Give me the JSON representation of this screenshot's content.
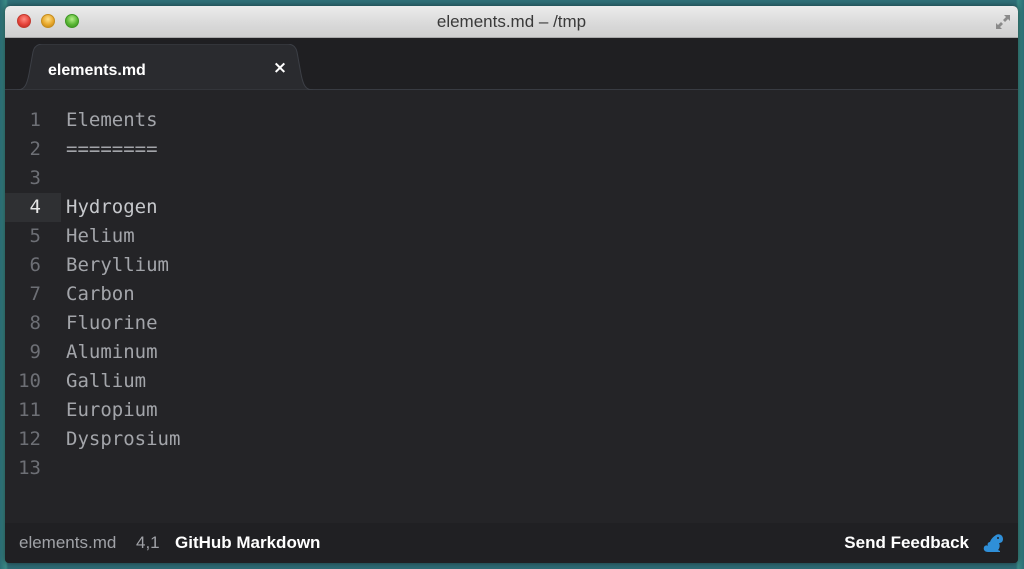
{
  "window": {
    "title": "elements.md – /tmp"
  },
  "tabs": [
    {
      "label": "elements.md",
      "close_icon": "close-icon",
      "close_glyph": "×"
    }
  ],
  "editor": {
    "current_line": 4,
    "lines": [
      {
        "number": "1",
        "text": "Elements"
      },
      {
        "number": "2",
        "text": "========"
      },
      {
        "number": "3",
        "text": ""
      },
      {
        "number": "4",
        "text": "Hydrogen"
      },
      {
        "number": "5",
        "text": "Helium"
      },
      {
        "number": "6",
        "text": "Beryllium"
      },
      {
        "number": "7",
        "text": "Carbon"
      },
      {
        "number": "8",
        "text": "Fluorine"
      },
      {
        "number": "9",
        "text": "Aluminum"
      },
      {
        "number": "10",
        "text": "Gallium"
      },
      {
        "number": "11",
        "text": "Europium"
      },
      {
        "number": "12",
        "text": "Dysprosium"
      },
      {
        "number": "13",
        "text": ""
      }
    ]
  },
  "statusbar": {
    "file": "elements.md",
    "cursor": "4,1",
    "grammar": "GitHub Markdown",
    "feedback_label": "Send Feedback",
    "feedback_icon": "squirrel-icon"
  },
  "colors": {
    "editor_bg": "#242427",
    "accent_blue": "#2f8fd8",
    "close_red": "#e5443b",
    "minimize_yellow": "#e8a82c",
    "zoom_green": "#59b635"
  }
}
